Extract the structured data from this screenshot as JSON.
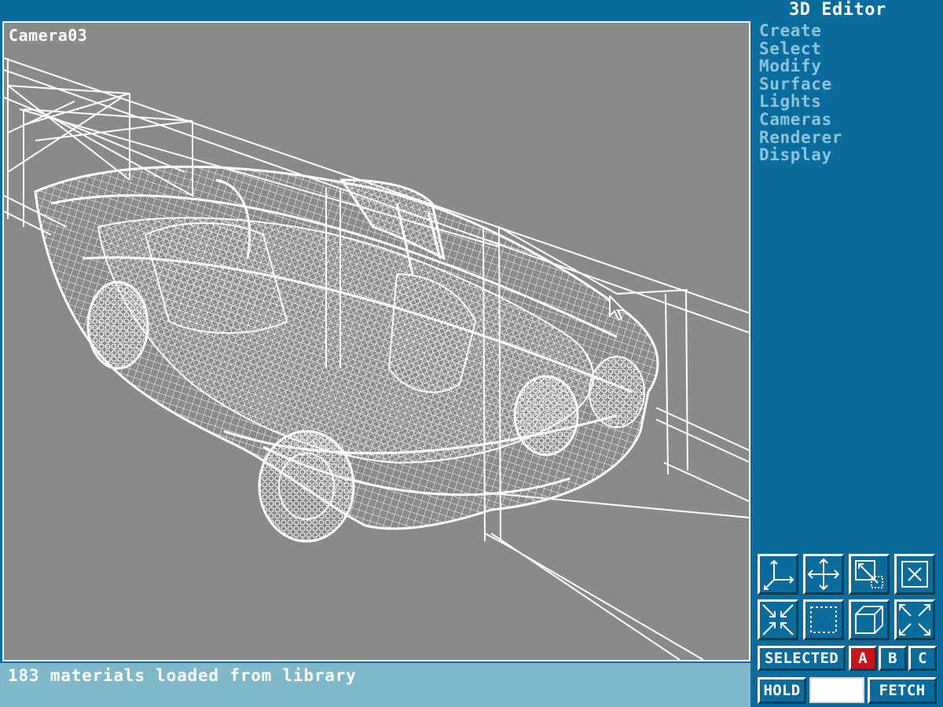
{
  "viewport": {
    "label": "Camera03"
  },
  "status": {
    "message": "183 materials loaded from library"
  },
  "editor": {
    "title": "3D Editor",
    "menu": [
      "Create",
      "Select",
      "Modify",
      "Surface",
      "Lights",
      "Cameras",
      "Renderer",
      "Display"
    ]
  },
  "toolbar": {
    "icons": [
      "axis-tripod-icon",
      "pan-icon",
      "zoom-window-icon",
      "close-x-icon",
      "zoom-in-icon",
      "zoom-region-icon",
      "box-icon",
      "zoom-extents-icon"
    ],
    "selected_label": "SELECTED",
    "a_label": "A",
    "b_label": "B",
    "c_label": "C",
    "hold_label": "HOLD",
    "fetch_label": "FETCH"
  },
  "colors": {
    "background": "#0a6c9c",
    "viewport": "#8a8a8a",
    "wireframe": "#ffffff",
    "menu_text": "#8cc4da",
    "status_bar": "#7fb8c9",
    "active_selection": "#c8141c"
  }
}
